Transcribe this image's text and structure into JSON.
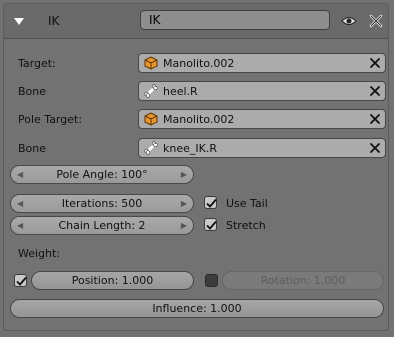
{
  "header": {
    "title": "IK",
    "name_value": "IK"
  },
  "rows": {
    "target_label": "Target:",
    "target_value": "Manolito.002",
    "bone_label": "Bone",
    "bone_value": "heel.R",
    "pole_target_label": "Pole Target:",
    "pole_target_value": "Manolito.002",
    "pole_bone_label": "Bone",
    "pole_bone_value": "knee_IK.R"
  },
  "pole_angle": "Pole Angle: 100°",
  "iterations": "Iterations: 500",
  "chain_length": "Chain Length: 2",
  "use_tail": {
    "label": "Use Tail",
    "checked": true
  },
  "stretch": {
    "label": "Stretch",
    "checked": true
  },
  "weight_label": "Weight:",
  "position": {
    "label": "Position: 1.000",
    "checked": true
  },
  "rotation": {
    "label": "Rotation: 1.000",
    "checked": false
  },
  "influence": "Influence: 1.000",
  "icons": [
    "collapse-triangle-icon",
    "eye-icon",
    "close-icon",
    "object-icon",
    "bone-icon",
    "clear-icon",
    "check-icon"
  ]
}
